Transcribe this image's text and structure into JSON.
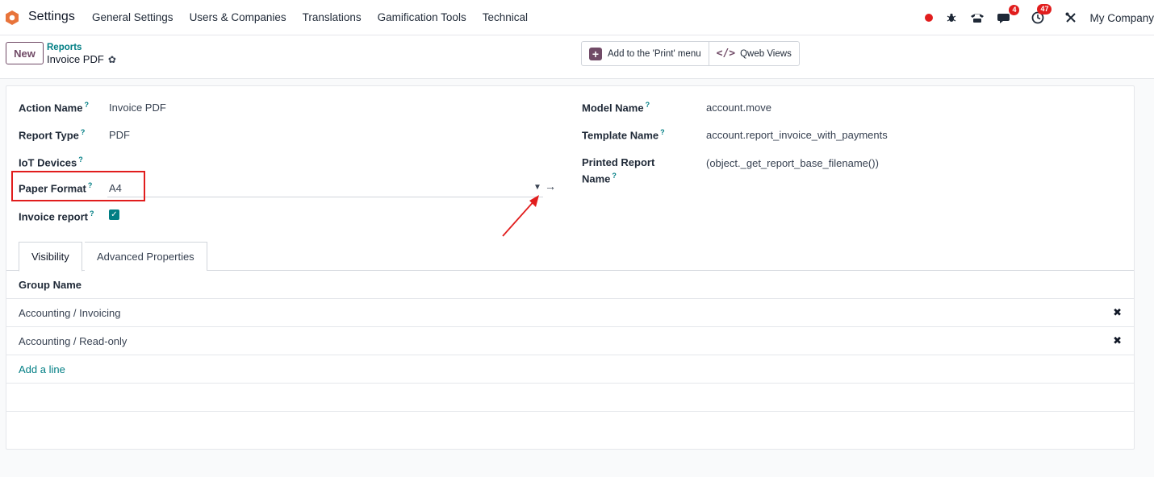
{
  "navbar": {
    "app_name": "Settings",
    "menu": [
      "General Settings",
      "Users & Companies",
      "Translations",
      "Gamification Tools",
      "Technical"
    ],
    "messages_badge": "4",
    "activities_badge": "47",
    "company": "My Company"
  },
  "control_panel": {
    "new_label": "New",
    "breadcrumb_parent": "Reports",
    "breadcrumb_current": "Invoice PDF",
    "add_print_menu_label": "Add to the 'Print' menu",
    "qweb_views_label": "Qweb Views"
  },
  "form": {
    "left": [
      {
        "label": "Action Name",
        "value": "Invoice PDF"
      },
      {
        "label": "Report Type",
        "value": "PDF"
      },
      {
        "label": "IoT Devices",
        "value": ""
      },
      {
        "label": "Paper Format",
        "value": "A4"
      },
      {
        "label": "Invoice report",
        "value": true
      }
    ],
    "right": [
      {
        "label": "Model Name",
        "value": "account.move"
      },
      {
        "label": "Template Name",
        "value": "account.report_invoice_with_payments"
      },
      {
        "label_line1": "Printed Report",
        "label_line2": "Name",
        "value": "(object._get_report_base_filename())"
      }
    ],
    "help_marker": "?"
  },
  "tabs": [
    {
      "label": "Visibility",
      "active": true
    },
    {
      "label": "Advanced Properties",
      "active": false
    }
  ],
  "groups_table": {
    "header": "Group Name",
    "rows": [
      "Accounting / Invoicing",
      "Accounting / Read-only"
    ],
    "add_line_label": "Add a line"
  },
  "colors": {
    "brand": "#714b67",
    "link": "#017e84",
    "highlight": "#e11d1d"
  }
}
